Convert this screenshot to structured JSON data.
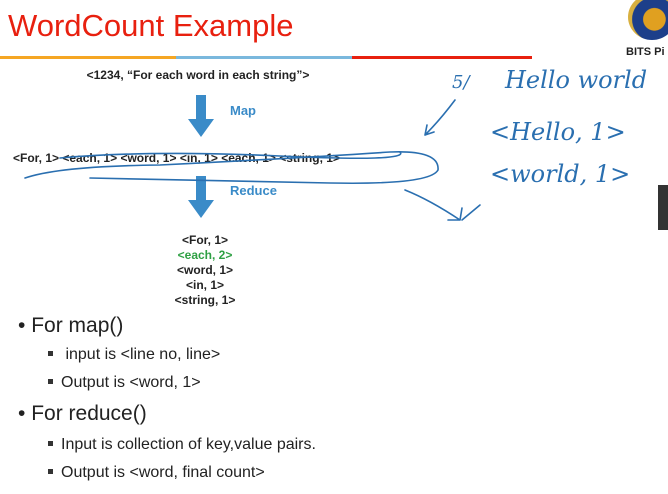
{
  "slide": {
    "title": "WordCount Example",
    "logo_text": "BITS Pi",
    "colors": {
      "title": "#e8200f",
      "orange": "#f5a623",
      "blue": "#7ab8dd",
      "red": "#e8200f",
      "arrow": "#3a8bc8",
      "highlight": "#2ea043"
    },
    "input": "<1234, “For each word in each string”>",
    "map_label": "Map",
    "map_output": [
      "<For, 1>",
      "<each, 1>",
      "<word, 1>",
      "<in, 1>",
      "<each, 1>",
      "<string, 1>"
    ],
    "reduce_label": "Reduce",
    "reduce_output": [
      "<For, 1>",
      "<each, 2>",
      "<word, 1>",
      "<in, 1>",
      "<string, 1>"
    ],
    "bullets": [
      {
        "text": "For map()",
        "sub": [
          "input is <line no, line>",
          "Output is <word, 1>"
        ]
      },
      {
        "text": "For reduce()",
        "sub": [
          "Input is collection of key,value pairs.",
          "Output is <word, final count>"
        ]
      }
    ],
    "annotations": {
      "mark": "5/",
      "line1": "Hello world",
      "line2": "<Hello, 1>",
      "line3": "<world, 1>"
    }
  }
}
